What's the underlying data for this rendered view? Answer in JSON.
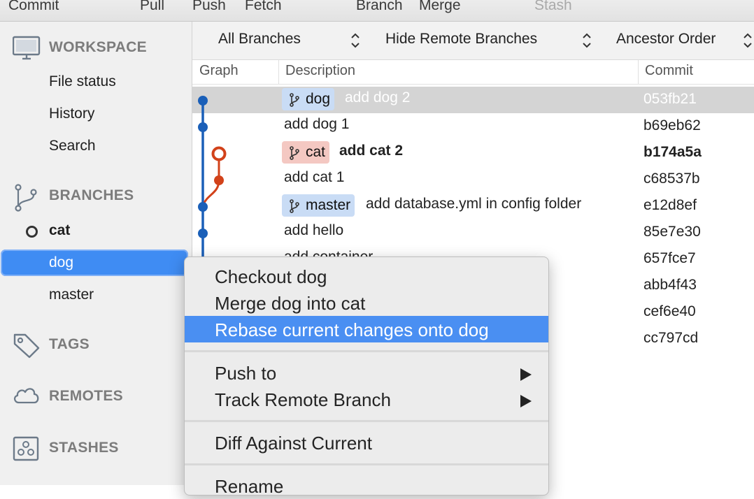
{
  "toolbar": {
    "commit": "Commit",
    "pull": "Pull",
    "push": "Push",
    "fetch": "Fetch",
    "branch": "Branch",
    "merge": "Merge",
    "stash": "Stash"
  },
  "sidebar": {
    "workspace": {
      "title": "WORKSPACE",
      "items": [
        "File status",
        "History",
        "Search"
      ]
    },
    "branches": {
      "title": "BRANCHES",
      "items": [
        {
          "name": "cat",
          "current": true
        },
        {
          "name": "dog",
          "selected": true
        },
        {
          "name": "master"
        }
      ]
    },
    "tags": {
      "title": "TAGS"
    },
    "remotes": {
      "title": "REMOTES"
    },
    "stashes": {
      "title": "STASHES"
    }
  },
  "filters": {
    "branches": "All Branches",
    "remote": "Hide Remote Branches",
    "order": "Ancestor Order"
  },
  "columns": {
    "graph": "Graph",
    "description": "Description",
    "commit": "Commit"
  },
  "commits": [
    {
      "branch_tag": "dog",
      "message": "add dog 2",
      "hash": "053fb21"
    },
    {
      "message": "add dog 1",
      "hash": "b69eb62"
    },
    {
      "branch_tag": "cat",
      "message": "add cat 2",
      "hash": "b174a5a"
    },
    {
      "message": "add cat 1",
      "hash": "c68537b"
    },
    {
      "branch_tag": "master",
      "message": "add database.yml in config folder",
      "hash": "e12d8ef"
    },
    {
      "message": "add hello",
      "hash": "85e7e30"
    },
    {
      "message": "add container",
      "hash": "657fce7"
    },
    {
      "message": "",
      "hash": "abb4f43"
    },
    {
      "message": "",
      "hash": "cef6e40"
    },
    {
      "message": "",
      "hash": "cc797cd"
    }
  ],
  "context_menu": {
    "checkout": "Checkout dog",
    "merge": "Merge dog into cat",
    "rebase": "Rebase current changes onto dog",
    "push_to": "Push to",
    "track": "Track Remote Branch",
    "diff": "Diff Against Current",
    "rename": "Rename"
  },
  "colors": {
    "accent_blue": "#3f8cf3",
    "graph_blue": "#1a5fb8",
    "graph_red": "#d2421a",
    "tag_blue": "#c9dcf5",
    "tag_red": "#f4c8c2"
  }
}
